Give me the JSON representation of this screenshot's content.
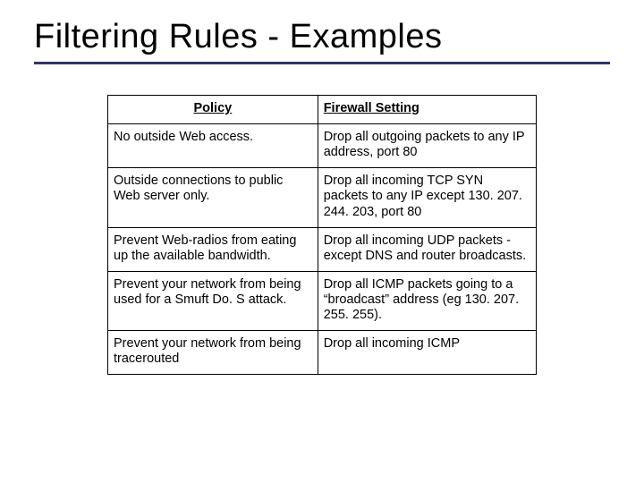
{
  "title": "Filtering Rules - Examples",
  "table": {
    "header": {
      "policy": "Policy",
      "setting": "Firewall Setting"
    },
    "rows": [
      {
        "policy": "No outside Web access.",
        "setting": "Drop all outgoing packets to any IP address, port 80"
      },
      {
        "policy": "Outside connections to public Web server only.",
        "setting": "Drop all incoming TCP SYN packets to any IP except 130. 207. 244. 203, port 80"
      },
      {
        "policy": "Prevent Web-radios from eating up the available bandwidth.",
        "setting": "Drop all incoming UDP packets - except DNS and router broadcasts."
      },
      {
        "policy": "Prevent your network from being used for a Smuft Do. S attack.",
        "setting": "Drop all ICMP packets going to a “broadcast” address (eg 130. 207. 255. 255)."
      },
      {
        "policy": "Prevent your network from being tracerouted",
        "setting": "Drop all incoming ICMP"
      }
    ]
  }
}
